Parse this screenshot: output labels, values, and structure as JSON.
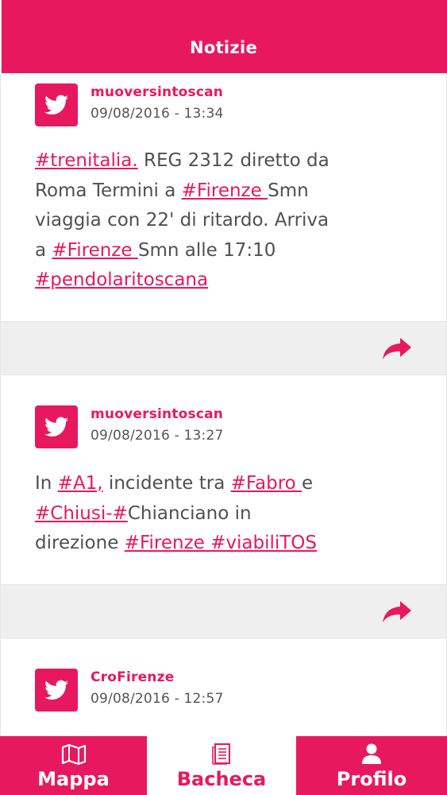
{
  "header": {
    "title": "Notizie"
  },
  "posts": [
    {
      "author": "muoversintoscan",
      "date": "09/08/2016 - 13:34",
      "lines": [
        [
          {
            "t": "#trenitalia.",
            "link": true
          },
          {
            "t": " REG 2312 diretto da"
          }
        ],
        [
          {
            "t": "Roma Termini a "
          },
          {
            "t": "#Firenze ",
            "link": true
          },
          {
            "t": "Smn"
          }
        ],
        [
          {
            "t": "viaggia con 22' di ritardo. Arriva"
          }
        ],
        [
          {
            "t": "a "
          },
          {
            "t": "#Firenze ",
            "link": true
          },
          {
            "t": "Smn alle 17:10"
          }
        ],
        [
          {
            "t": "#pendolaritoscana",
            "link": true
          }
        ]
      ]
    },
    {
      "author": "muoversintoscan",
      "date": "09/08/2016 - 13:27",
      "lines": [
        [
          {
            "t": "In "
          },
          {
            "t": "#A1,",
            "link": true
          },
          {
            "t": " incidente tra "
          },
          {
            "t": "#Fabro ",
            "link": true
          },
          {
            "t": "e"
          }
        ],
        [
          {
            "t": "#Chiusi-#",
            "link": true
          },
          {
            "t": "Chianciano in"
          }
        ],
        [
          {
            "t": "direzione "
          },
          {
            "t": "#Firenze #viabiliTOS",
            "link": true
          }
        ]
      ]
    },
    {
      "author": "CroFirenze",
      "date": "09/08/2016 - 12:57",
      "lines": []
    }
  ],
  "icons": {
    "post": "twitter-bird-icon",
    "share": "share-arrow-icon",
    "map": "map-icon",
    "board": "document-icon",
    "profile": "user-icon"
  },
  "tabs": [
    {
      "label": "Mappa",
      "active": false
    },
    {
      "label": "Bacheca",
      "active": true
    },
    {
      "label": "Profilo",
      "active": false
    }
  ],
  "colors": {
    "accent": "#e8185f",
    "bar": "#efefef",
    "text": "#505050"
  }
}
